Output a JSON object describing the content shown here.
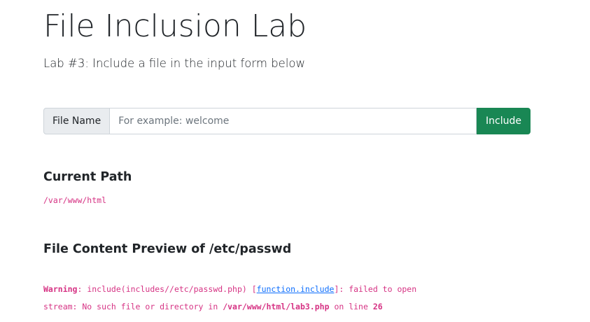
{
  "header": {
    "title": "File Inclusion Lab",
    "subtitle": "Lab #3: Include a file in the input form below"
  },
  "form": {
    "addon_label": "File Name",
    "input_value": "",
    "input_placeholder": "For example: welcome",
    "submit_label": "Include"
  },
  "current_path": {
    "heading": "Current Path",
    "value": "/var/www/html"
  },
  "preview": {
    "heading_prefix": "File Content Preview of",
    "file": "/etc/passwd",
    "warning": {
      "label": "Warning",
      "text_before_link": ": include(includes//etc/passwd.php) [",
      "link": "function.include",
      "text_after_link": "]: failed to open",
      "line2_prefix": "stream: No such file or directory in ",
      "path": "/var/www/html/lab3.php",
      "line2_middle": " on line ",
      "line_number": "26"
    }
  },
  "colors": {
    "accent_green": "#198754",
    "code_pink": "#d63384",
    "link_blue": "#0d6efd",
    "addon_bg": "#e9ecef"
  }
}
